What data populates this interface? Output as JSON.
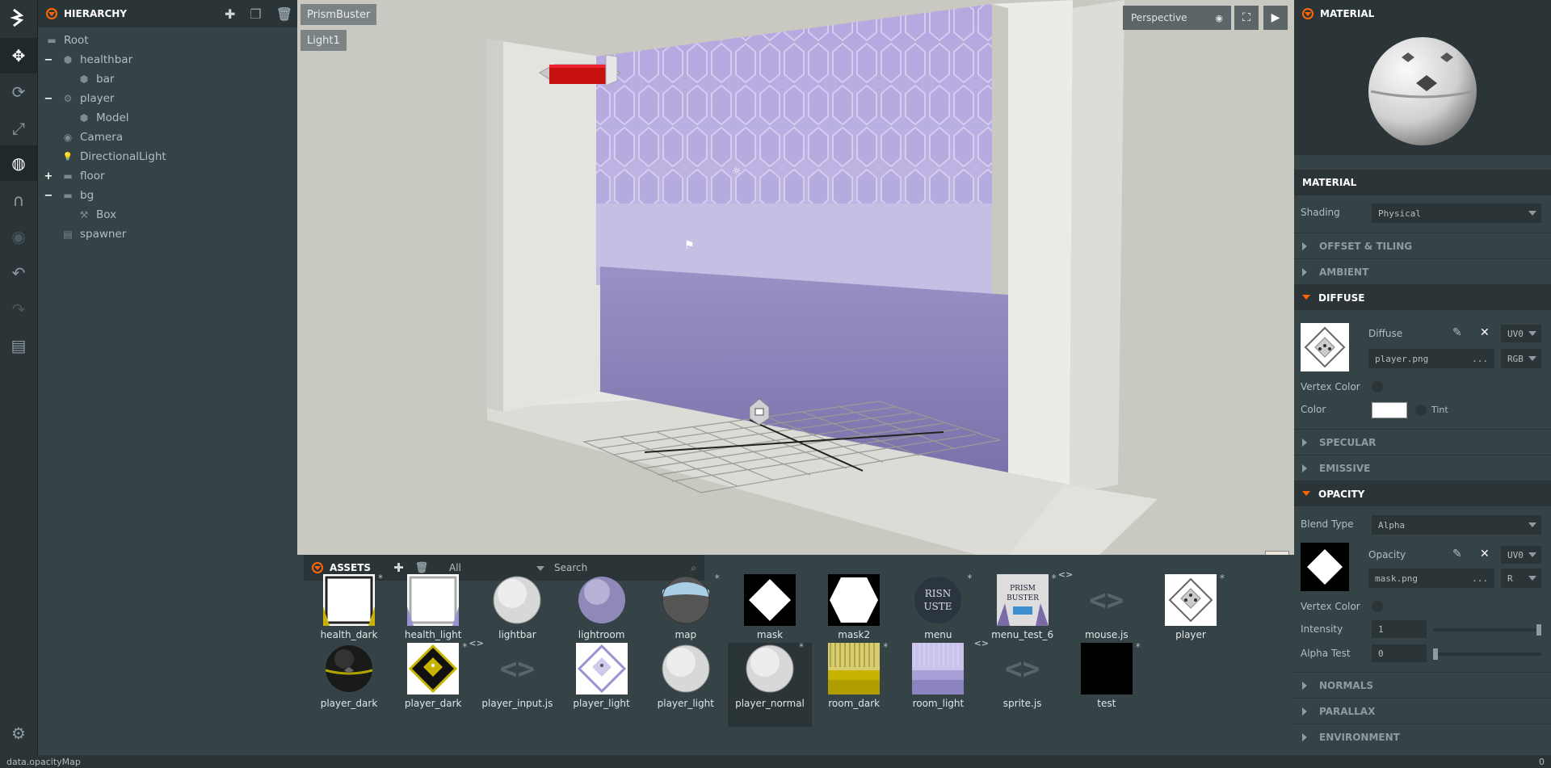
{
  "hierarchy": {
    "title": "HIERARCHY",
    "items": [
      {
        "label": "Root",
        "depth": 0,
        "icon": "folder-icon",
        "expander": ""
      },
      {
        "label": "healthbar",
        "depth": 1,
        "icon": "cube-icon",
        "expander": "−"
      },
      {
        "label": "bar",
        "depth": 2,
        "icon": "cube-icon",
        "expander": ""
      },
      {
        "label": "player",
        "depth": 1,
        "icon": "gear-icon",
        "expander": "−"
      },
      {
        "label": "Model",
        "depth": 2,
        "icon": "cube-icon",
        "expander": ""
      },
      {
        "label": "Camera",
        "depth": 1,
        "icon": "eye-icon",
        "expander": ""
      },
      {
        "label": "DirectionalLight",
        "depth": 1,
        "icon": "bulb-icon",
        "expander": ""
      },
      {
        "label": "floor",
        "depth": 1,
        "icon": "folder-icon",
        "expander": "+"
      },
      {
        "label": "bg",
        "depth": 1,
        "icon": "folder-icon",
        "expander": "−"
      },
      {
        "label": "Box",
        "depth": 2,
        "icon": "hammer-icon",
        "expander": ""
      },
      {
        "label": "spawner",
        "depth": 1,
        "icon": "script-icon",
        "expander": ""
      }
    ]
  },
  "viewport": {
    "tag1": "PrismBuster",
    "tag2": "Light1",
    "camera": "Perspective"
  },
  "assets": {
    "title": "ASSETS",
    "filter": "All",
    "search_placeholder": "Search",
    "row1": [
      {
        "label": "health_dark",
        "star": "*",
        "kind": "health_dark"
      },
      {
        "label": "health_light",
        "star": "",
        "kind": "health_light"
      },
      {
        "label": "lightbar",
        "star": "",
        "kind": "sphere_white"
      },
      {
        "label": "lightroom",
        "star": "",
        "kind": "sphere_purple"
      },
      {
        "label": "map",
        "star": "*",
        "kind": "sphere_map"
      },
      {
        "label": "mask",
        "star": "",
        "kind": "mask"
      },
      {
        "label": "mask2",
        "star": "",
        "kind": "mask2"
      },
      {
        "label": "menu",
        "star": "*",
        "kind": "menu"
      },
      {
        "label": "menu_test_6",
        "star": "*",
        "kind": "menu_test"
      },
      {
        "label": "mouse.js",
        "star": "",
        "kind": "script"
      },
      {
        "label": "player",
        "star": "*",
        "kind": "player_tex"
      }
    ],
    "row2": [
      {
        "label": "player_dark",
        "star": "",
        "kind": "sphere_dark"
      },
      {
        "label": "player_dark",
        "star": "*",
        "kind": "player_dark_tex"
      },
      {
        "label": "player_input.js",
        "star": "",
        "kind": "script"
      },
      {
        "label": "player_light",
        "star": "",
        "kind": "player_light_tex"
      },
      {
        "label": "player_light",
        "star": "",
        "kind": "sphere_white"
      },
      {
        "label": "player_normal",
        "star": "*",
        "kind": "sphere_white",
        "selected": true
      },
      {
        "label": "room_dark",
        "star": "*",
        "kind": "room_dark"
      },
      {
        "label": "room_light",
        "star": "",
        "kind": "room_light"
      },
      {
        "label": "sprite.js",
        "star": "",
        "kind": "script"
      },
      {
        "label": "test",
        "star": "*",
        "kind": "black"
      }
    ],
    "script_glyph": "<>"
  },
  "material": {
    "title": "MATERIAL",
    "section_title": "MATERIAL",
    "shading_label": "Shading",
    "shading_value": "Physical",
    "sections": {
      "offset": "OFFSET & TILING",
      "ambient": "AMBIENT",
      "diffuse": "DIFFUSE",
      "specular": "SPECULAR",
      "emissive": "EMISSIVE",
      "opacity": "OPACITY",
      "normals": "NORMALS",
      "parallax": "PARALLAX",
      "environment": "ENVIRONMENT"
    },
    "diffuse": {
      "label": "Diffuse",
      "uv": "UV0",
      "file": "player.png",
      "channel": "RGB",
      "dots": "...",
      "vertex_color_label": "Vertex Color",
      "color_label": "Color",
      "tint_label": "Tint"
    },
    "opacity": {
      "blend_label": "Blend Type",
      "blend_value": "Alpha",
      "label": "Opacity",
      "uv": "UV0",
      "file": "mask.png",
      "channel": "R",
      "dots": "...",
      "vertex_color_label": "Vertex Color",
      "intensity_label": "Intensity",
      "intensity_value": "1",
      "intensity_level": 1.0,
      "alpha_test_label": "Alpha Test",
      "alpha_test_value": "0",
      "alpha_test_level": 0.0
    }
  },
  "status": {
    "left": "data.opacityMap",
    "right": "0"
  },
  "colors": {
    "accent": "#ff6600",
    "panel": "#364346",
    "panel_dark": "#2b3538"
  }
}
